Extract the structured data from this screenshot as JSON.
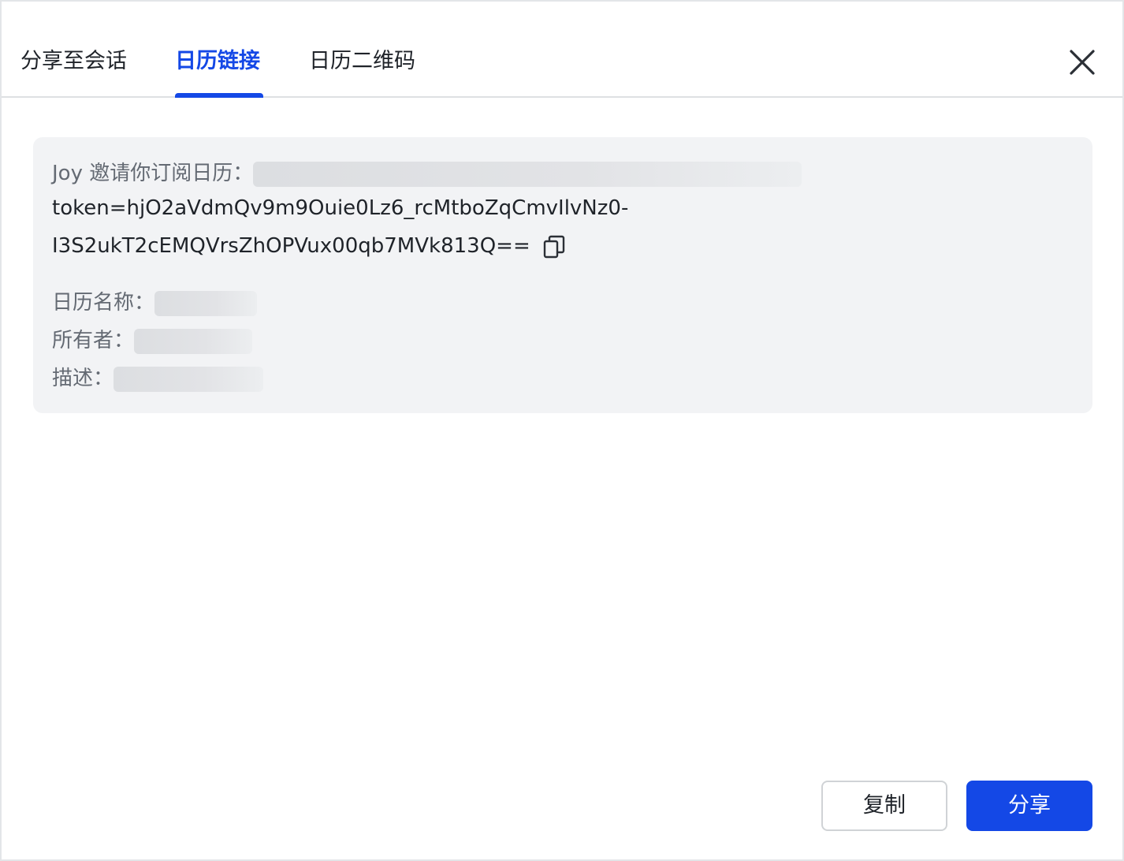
{
  "tabs": {
    "share_to_chat": "分享至会话",
    "calendar_link": "日历链接",
    "calendar_qrcode": "日历二维码"
  },
  "colors": {
    "accent": "#1448e6",
    "text_primary": "#1f2329",
    "text_secondary": "#646a73",
    "card_bg": "#f2f3f5"
  },
  "card": {
    "invite_text": "Joy 邀请你订阅日历：",
    "token_line1": "token=hjO2aVdmQv9m9Ouie0Lz6_rcMtboZqCmvIlvNz0-",
    "token_line2": "I3S2ukT2cEMQVrsZhOPVux00qb7MVk813Q==",
    "calendar_name_label": "日历名称：",
    "owner_label": "所有者：",
    "description_label": "描述："
  },
  "footer": {
    "copy_label": "复制",
    "share_label": "分享"
  }
}
